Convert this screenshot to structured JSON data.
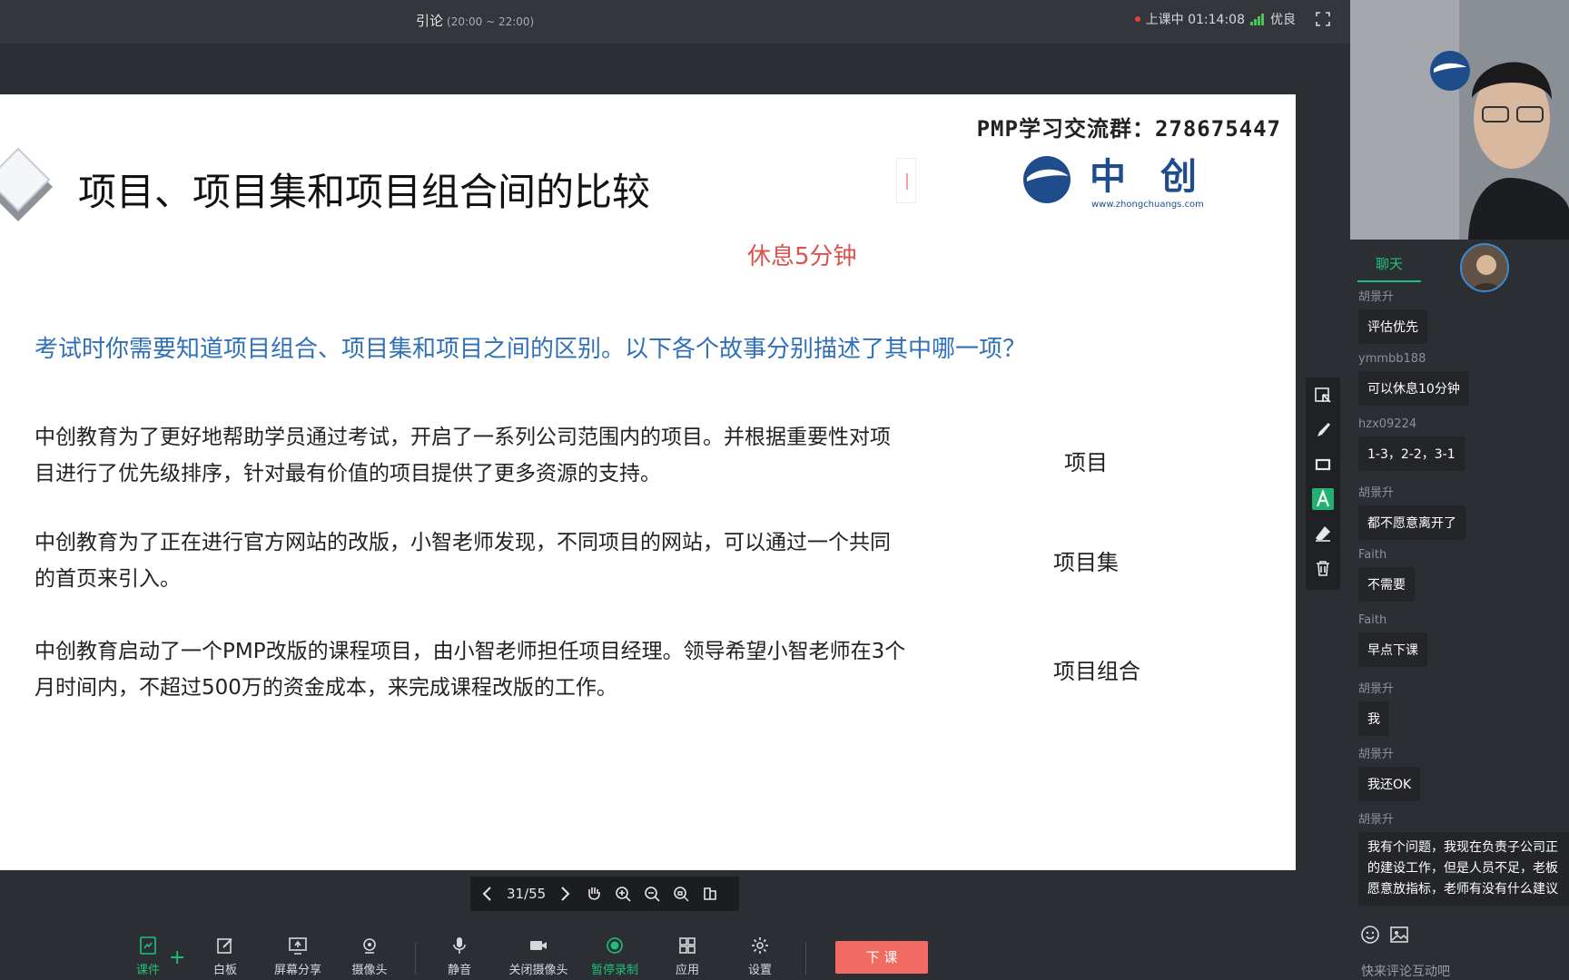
{
  "window": {
    "title": "引论",
    "time_range": "(20:00 ~ 22:00)",
    "status_label": "上课中 01:14:08",
    "network_label": "优良"
  },
  "slide": {
    "group_text": "PMP学习交流群：278675447",
    "title": "项目、项目集和项目组合间的比较",
    "brand_cn": "中创",
    "brand_url": "www.zhongchuangs.com",
    "rest_note": "休息5分钟",
    "question": "考试时你需要知道项目组合、项目集和项目之间的区别。以下各个故事分别描述了其中哪一项？",
    "stories": [
      {
        "text": "中创教育为了更好地帮助学员通过考试，开启了一系列公司范围内的项目。并根据重要性对项目进行了优先级排序，针对最有价值的项目提供了更多资源的支持。",
        "answer": "项目"
      },
      {
        "text": "中创教育为了正在进行官方网站的改版，小智老师发现，不同项目的网站，可以通过一个共同的首页来引入。",
        "answer": "项目集"
      },
      {
        "text": "中创教育启动了一个PMP改版的课程项目，由小智老师担任项目经理。领导希望小智老师在3个月时间内，不超过500万的资金成本，来完成课程改版的工作。",
        "answer": "项目组合"
      }
    ]
  },
  "pager": {
    "page_label": "31/55"
  },
  "toolbar": {
    "courseware": "课件",
    "whiteboard": "白板",
    "screen_share": "屏幕分享",
    "camera": "摄像头",
    "mute": "静音",
    "close_camera": "关闭摄像头",
    "pause_record": "暂停录制",
    "apps": "应用",
    "settings": "设置",
    "end_class": "下 课"
  },
  "chat": {
    "tab_label": "聊天",
    "input_placeholder": "快来评论互动吧",
    "messages": [
      {
        "name": "胡景升",
        "text": "评估优先"
      },
      {
        "name": "ymmbb188",
        "text": "可以休息10分钟"
      },
      {
        "name": "hzx09224",
        "text": "1-3，2-2，3-1"
      },
      {
        "name": "胡景升",
        "text": "都不愿意离开了"
      },
      {
        "name": "Faith",
        "text": "不需要"
      },
      {
        "name": "Faith",
        "text": "早点下课"
      },
      {
        "name": "胡景升",
        "text": "我"
      },
      {
        "name": "胡景升",
        "text": "我还OK"
      },
      {
        "name": "胡景升",
        "text": "我有个问题，我现在负责子公司正的建设工作，但是人员不足，老板愿意放指标，老师有没有什么建议"
      }
    ]
  },
  "colors": {
    "accent_green": "#20c07a",
    "end_button": "#f26b63",
    "question_blue": "#2f70b8",
    "rest_red": "#d9534f",
    "brand_blue": "#1f4d8c"
  }
}
